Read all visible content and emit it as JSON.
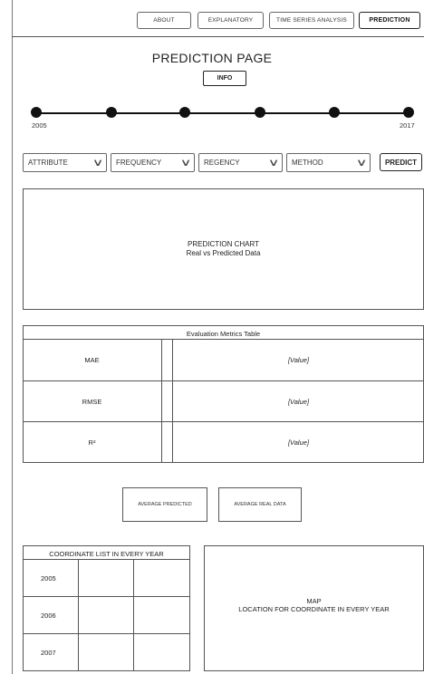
{
  "nav": {
    "items": [
      {
        "label": "ABOUT"
      },
      {
        "label": "EXPLANATORY"
      },
      {
        "label": "TIME SERIES ANALYSIS"
      },
      {
        "label": "PREDICTION"
      }
    ],
    "active": "PREDICTION"
  },
  "header": {
    "title": "PREDICTION PAGE",
    "info_label": "INFO"
  },
  "timeline": {
    "start_year": "2005",
    "end_year": "2017",
    "points": 6
  },
  "controls": {
    "dropdowns": [
      {
        "label": "ATTRIBUTE"
      },
      {
        "label": "FREQUENCY"
      },
      {
        "label": "REGENCY"
      },
      {
        "label": "METHOD"
      }
    ],
    "predict_label": "PREDICT"
  },
  "chart": {
    "title": "PREDICTION CHART",
    "subtitle": "Real vs Predicted Data"
  },
  "metrics": {
    "title": "Evaluation Metrics Table",
    "rows": [
      {
        "name": "MAE",
        "value": "[Value]"
      },
      {
        "name": "RMSE",
        "value": "[Value]"
      },
      {
        "name": "R²",
        "value": "[Value]"
      }
    ]
  },
  "summary": {
    "avg_predicted_label": "AVERAGE PREDICTED",
    "avg_real_label": "AVERAGE REAL DATA"
  },
  "coordinates": {
    "title": "COORDINATE LIST IN EVERY YEAR",
    "years": [
      "2005",
      "2006",
      "2007"
    ]
  },
  "map": {
    "title": "MAP",
    "subtitle": "LOCATION FOR COORDINATE IN EVERY YEAR"
  }
}
